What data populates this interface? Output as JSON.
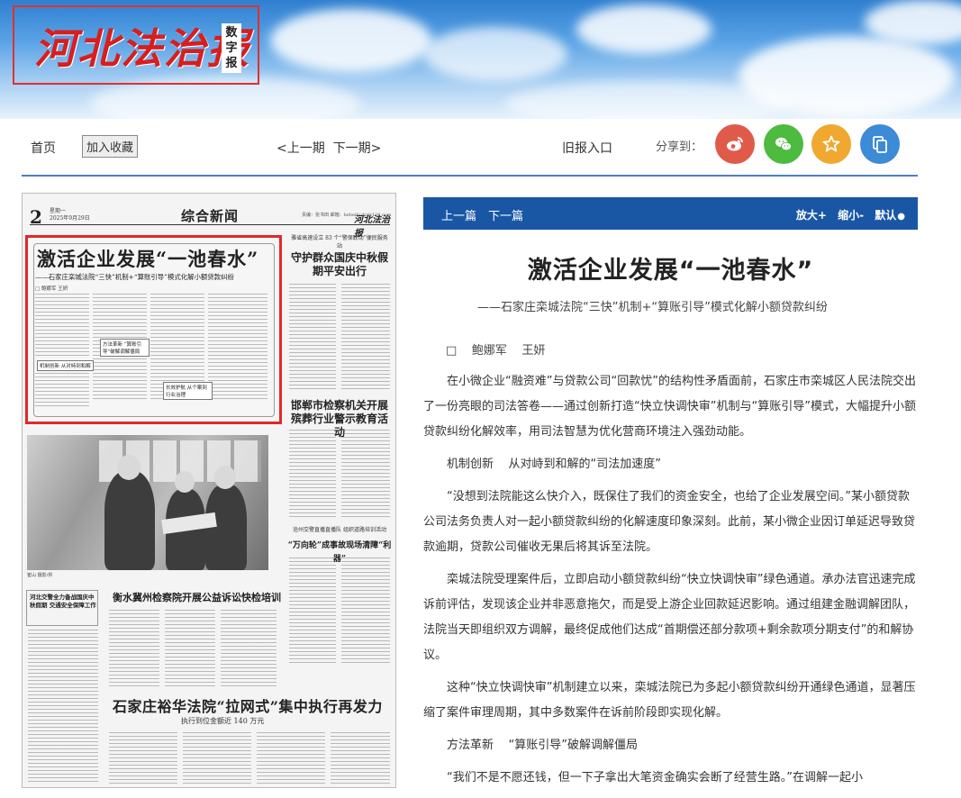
{
  "header": {
    "logo_text": "河北法治报",
    "logo_sub": [
      "数",
      "字",
      "报"
    ]
  },
  "toolbar": {
    "home": "首页",
    "add_favorite": "加入收藏",
    "prev_issue": "<上一期",
    "next_issue": "下一期>",
    "old_issue": "旧报入口",
    "share_label": "分享到：",
    "share_buttons": [
      {
        "name": "weibo",
        "color": "#e05a4a"
      },
      {
        "name": "wechat",
        "color": "#4cbb3f"
      },
      {
        "name": "favorite",
        "color": "#f0a830"
      },
      {
        "name": "copy",
        "color": "#3d8ad6"
      }
    ]
  },
  "paper": {
    "page_number": "2",
    "date_lines": [
      "星期一",
      "2025年9月29日"
    ],
    "section": "综合新闻",
    "masthead_url": "责编：张书田 邮箱：hebeifazhi@126.com",
    "masthead": "河北法治报",
    "lead_title": "激活企业发展“一池春水”",
    "lead_subtitle": "——石家庄栾城法院“三快”机制+“算账引导”模式化解小额贷款纠纷",
    "lead_author": "□ 鲍娜军 王妍",
    "box_labels": [
      "机制创新 从对峙到和解",
      "方法革新 “算账引导”破解调解僵局",
      "长效护航 从个案到行业治理"
    ],
    "side_kicker": "雅省高速设立 83 个“警保联动”便民服务站",
    "side_head": "守护群众国庆中秋假期平安出行",
    "side_head2": "邯郸市检察机关开展殡葬行业警示教育活动",
    "side_kicker3": "沧州交警直播直播队 组织道路培训活动",
    "side_head3": "“万向轮”成事故现场清障“利器”",
    "photo_caption": "崔山 摄影/供",
    "vbar_text": "河北交警全力备战国庆中秋假期 交通安全保障工作",
    "mid_head": "衡水冀州检察院开展公益诉讼快检培训",
    "big_head": "石家庄裕华法院“拉网式”集中执行再发力",
    "big_sub": "执行到位金额近 140 万元"
  },
  "article": {
    "prev": "上一篇",
    "next": "下一篇",
    "zoom_in": "放大+",
    "zoom_out": "缩小-",
    "default": "默认",
    "title": "激活企业发展“一池春水”",
    "subtitle": "——石家庄栾城法院“三快”机制+“算账引导”模式化解小额贷款纠纷",
    "author": "□    鲍娜军    王妍",
    "p1": "在小微企业“融资难”与贷款公司“回款忧”的结构性矛盾面前，石家庄市栾城区人民法院交出了一份亮眼的司法答卷——通过创新打造“快立快调快审”机制与“算账引导”模式，大幅提升小额贷款纠纷化解效率，用司法智慧为优化营商环境注入强劲动能。",
    "sec1": "机制创新    从对峙到和解的“司法加速度”",
    "p2": "“没想到法院能这么快介入，既保住了我们的资金安全，也给了企业发展空间。”某小额贷款公司法务负责人对一起小额贷款纠纷的化解速度印象深刻。此前，某小微企业因订单延迟导致贷款逾期，贷款公司催收无果后将其诉至法院。",
    "p3": "栾城法院受理案件后，立即启动小额贷款纠纷“快立快调快审”绿色通道。承办法官迅速完成诉前评估，发现该企业并非恶意拖欠，而是受上游企业回款延迟影响。通过组建金融调解团队，法院当天即组织双方调解，最终促成他们达成“首期偿还部分款项+剩余款项分期支付”的和解协议。",
    "p4": "这种“快立快调快审”机制建立以来，栾城法院已为多起小额贷款纠纷开通绿色通道，显著压缩了案件审理周期，其中多数案件在诉前阶段即实现化解。",
    "sec2": "方法革新    “算账引导”破解调解僵局",
    "p5": "“我们不是不愿还钱，但一下子拿出大笔资金确实会断了经营生路。”在调解一起小"
  }
}
